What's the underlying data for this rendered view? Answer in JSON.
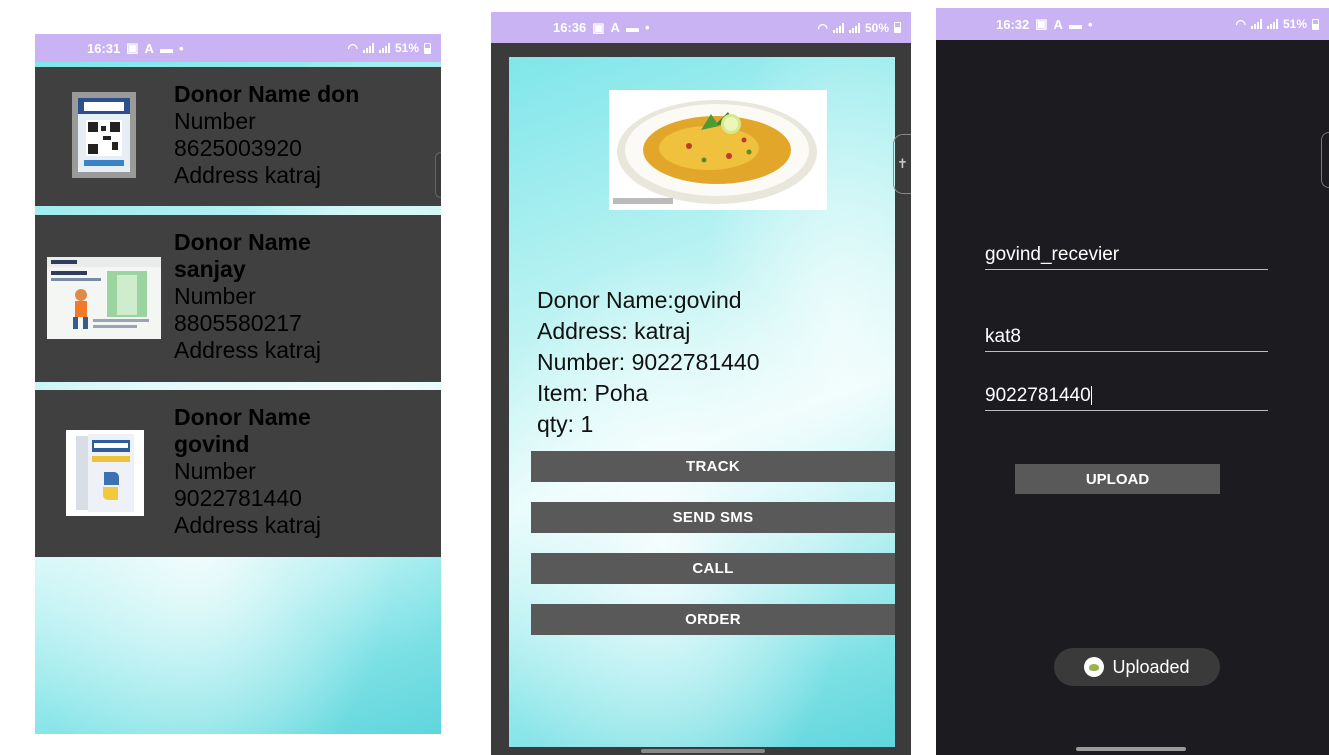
{
  "phone1": {
    "status": {
      "time": "16:31",
      "battery": "51%"
    },
    "donors": [
      {
        "name": "Donor Name don",
        "number_label": "Number",
        "number": "8625003920",
        "address": "Address katraj",
        "image_icon": "paytm-qr-image"
      },
      {
        "name_line1": "Donor Name",
        "name_line2": "sanjay",
        "number_label": "Number",
        "number": "8805580217",
        "address": "Address katraj",
        "image_icon": "career-ad-image"
      },
      {
        "name_line1": "Donor Name",
        "name_line2": "govind",
        "number_label": "Number",
        "number": "9022781440",
        "address": "Address katraj",
        "image_icon": "python-book-image"
      }
    ]
  },
  "phone2": {
    "status": {
      "time": "16:36",
      "battery": "50%"
    },
    "details": {
      "donor": "Donor Name:govind",
      "address": "Address: katraj",
      "number": "Number: 9022781440",
      "item": "Item: Poha",
      "qty": "qty: 1"
    },
    "buttons": {
      "track": "TRACK",
      "send_sms": "SEND SMS",
      "call": "CALL",
      "order": "ORDER"
    }
  },
  "phone3": {
    "status": {
      "time": "16:32",
      "battery": "51%"
    },
    "fields": {
      "name": "govind_recevier",
      "address": "kat8",
      "phone": "9022781440"
    },
    "upload_label": "UPLOAD",
    "toast": "Uploaded"
  },
  "colors": {
    "status_bar": "#c9b3f2",
    "card_bg": "#404040",
    "button_bg": "#595959",
    "dark_bg": "#1c1b1f"
  }
}
